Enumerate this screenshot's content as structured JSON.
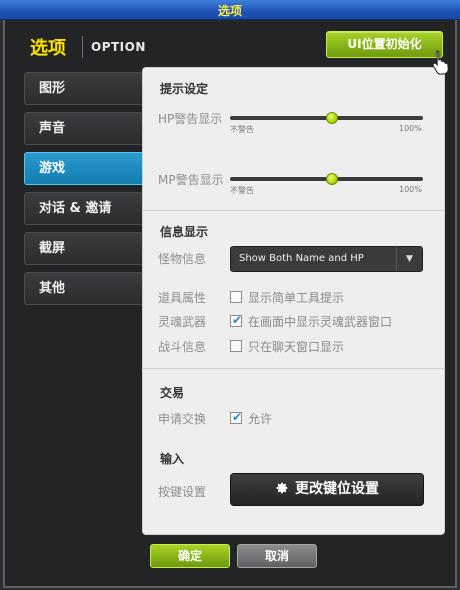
{
  "window": {
    "title": "选项"
  },
  "header": {
    "title": "选项",
    "subtitle": "OPTION",
    "reset_label": "UI位置初始化"
  },
  "tabs": [
    {
      "label": "图形",
      "active": false
    },
    {
      "label": "声音",
      "active": false
    },
    {
      "label": "游戏",
      "active": true
    },
    {
      "label": "对话 & 邀请",
      "active": false
    },
    {
      "label": "截屏",
      "active": false
    },
    {
      "label": "其他",
      "active": false
    }
  ],
  "hint": {
    "title": "提示设定",
    "hp": {
      "label": "HP警告显示",
      "min": "不警告",
      "max": "100%",
      "value_pct": 53
    },
    "mp": {
      "label": "MP警告显示",
      "min": "不警告",
      "max": "100%",
      "value_pct": 53
    }
  },
  "info": {
    "title": "信息显示",
    "monster": {
      "label": "怪物信息",
      "value": "Show Both Name and HP"
    },
    "item_attr": {
      "label": "道具属性",
      "text": "显示简单工具提示",
      "checked": false
    },
    "soul_weapon": {
      "label": "灵魂武器",
      "text": "在画面中显示灵魂武器窗口",
      "checked": true
    },
    "battle_info": {
      "label": "战斗信息",
      "text": "只在聊天窗口显示",
      "checked": false
    }
  },
  "trade": {
    "title": "交易",
    "exchange": {
      "label": "申请交换",
      "text": "允许",
      "checked": true
    }
  },
  "input": {
    "title": "输入",
    "keybind": {
      "label": "按键设置",
      "button": "更改键位设置"
    }
  },
  "footer": {
    "ok": "确定",
    "cancel": "取消"
  },
  "colors": {
    "accent_green": "#8fc31f",
    "active_tab": "#1b8cc2",
    "title_yellow": "#ffe400"
  }
}
